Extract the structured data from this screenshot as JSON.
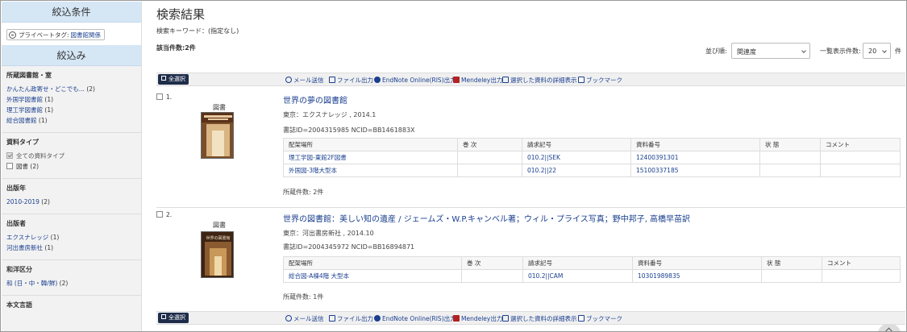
{
  "sidebar": {
    "narrow_conditions_header": "絞込条件",
    "private_tag": {
      "label": "プライベートタグ:",
      "value": "図書館関係"
    },
    "narrow_header": "絞込み",
    "facets": [
      {
        "title": "所蔵図書館・室",
        "items": [
          {
            "label": "かんたん政寄せ・どこでも...",
            "count": "(2)"
          },
          {
            "label": "外国学図書館",
            "count": "(1)"
          },
          {
            "label": "理工学図書館",
            "count": "(1)"
          },
          {
            "label": "総合図書館",
            "count": "(1)"
          }
        ]
      },
      {
        "title": "資料タイプ",
        "items": [
          {
            "label": "全ての資料タイプ",
            "count": "",
            "checked": true
          },
          {
            "label": "図書",
            "count": "(2)",
            "checked": false
          }
        ]
      },
      {
        "title": "出版年",
        "items": [
          {
            "label": "2010-2019",
            "count": "(2)"
          }
        ]
      },
      {
        "title": "出版者",
        "items": [
          {
            "label": "エクスナレッジ",
            "count": "(1)"
          },
          {
            "label": "河出書房新社",
            "count": "(1)"
          }
        ]
      },
      {
        "title": "和洋区分",
        "items": [
          {
            "label": "和 (日・中・韓/鮮)",
            "count": "(2)"
          }
        ]
      },
      {
        "title": "本文言語",
        "items": []
      }
    ]
  },
  "main": {
    "title": "検索結果",
    "keyword": "検索キーワード：(指定なし)",
    "count": "該当件数:2件",
    "sort_label": "並び順:",
    "sort_value": "関連度",
    "perpage_label": "一覧表示件数:",
    "perpage_value": "20",
    "perpage_unit": "件",
    "toolbar": {
      "select_all": "全選択",
      "mail": "メール送信",
      "file": "ファイル出力",
      "endnote": "EndNote Online(RIS)出力",
      "mendeley": "Mendeley出力",
      "details": "選択した資料の詳細表示",
      "bookmark": "ブックマーク"
    },
    "table_headers": [
      "配架場所",
      "巻 次",
      "請求記号",
      "資料番号",
      "状 態",
      "コメント"
    ],
    "records": [
      {
        "index": "1.",
        "type": "図書",
        "title": "世界の夢の図書館",
        "publication": "東京：エクスナレッジ , 2014.1",
        "ids": "書誌ID=2004315985 NCID=BB1461883X",
        "holdings": [
          {
            "location": "理工学図-東館2F図書",
            "volume": "",
            "call": "010.2||SEK",
            "number": "12400391301",
            "status": "",
            "comment": ""
          },
          {
            "location": "外国図-3階大型本",
            "volume": "",
            "call": "010.2||22",
            "number": "15100337185",
            "status": "",
            "comment": ""
          }
        ],
        "holding_count": "所蔵件数: 2件",
        "cover_text": "世界の夢の図書館"
      },
      {
        "index": "2.",
        "type": "図書",
        "title": "世界の図書館：美しい知の遺産 / ジェームズ・W.P.キャンベル著；ウィル・プライス写真；野中邦子, 高橋早苗訳",
        "publication": "東京：河出書房新社 , 2014.10",
        "ids": "書誌ID=2004345972 NCID=BB16894871",
        "holdings": [
          {
            "location": "総合図-A棟4階 大型本",
            "volume": "",
            "call": "010.2||CAM",
            "number": "10301989835",
            "status": "",
            "comment": ""
          }
        ],
        "holding_count": "所蔵件数: 1件",
        "cover_text": "世界の図書館"
      }
    ]
  }
}
